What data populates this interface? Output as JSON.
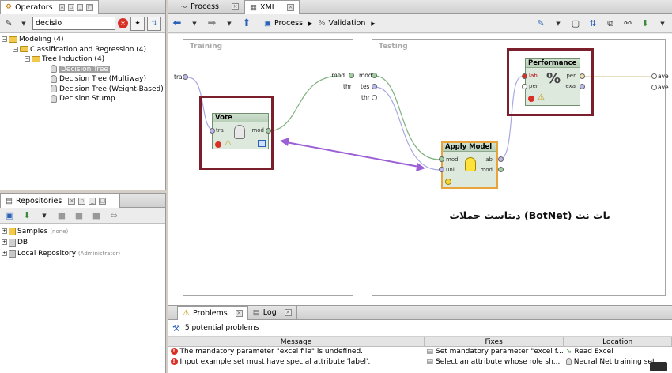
{
  "operators_panel": {
    "tab_label": "Operators",
    "search_value": "decisio",
    "tree": [
      {
        "label": "Modeling (4)",
        "level": 0,
        "kind": "folder"
      },
      {
        "label": "Classification and Regression (4)",
        "level": 1,
        "kind": "folder"
      },
      {
        "label": "Tree Induction (4)",
        "level": 2,
        "kind": "folder"
      },
      {
        "label": "Decision Tree",
        "level": 3,
        "kind": "operator",
        "selected": true
      },
      {
        "label": "Decision Tree (Multiway)",
        "level": 3,
        "kind": "operator"
      },
      {
        "label": "Decision Tree (Weight-Based)",
        "level": 3,
        "kind": "operator"
      },
      {
        "label": "Decision Stump",
        "level": 3,
        "kind": "operator"
      }
    ]
  },
  "repositories_panel": {
    "tab_label": "Repositories",
    "items": [
      {
        "label": "Samples",
        "note": "(none)"
      },
      {
        "label": "DB",
        "note": ""
      },
      {
        "label": "Local Repository",
        "note": "(Administrator)"
      }
    ]
  },
  "process_tabs": {
    "process_label": "Process",
    "xml_label": "XML"
  },
  "process_toolbar": {
    "breadcrumb_process": "Process",
    "breadcrumb_validation": "Validation"
  },
  "canvas": {
    "training_title": "Training",
    "testing_title": "Testing",
    "training_in_port": "tra",
    "training_out_ports": [
      "mod",
      "mod"
    ],
    "testing_in_ports": [
      "tes",
      "thr"
    ],
    "testing_left_ports": [
      "mod",
      "thr"
    ],
    "testing_out_ports": [
      "ave",
      "ave"
    ],
    "vote": {
      "title": "Vote",
      "in_port": "tra",
      "out_port": "mod"
    },
    "apply_model": {
      "title": "Apply Model",
      "in_ports": [
        "mod",
        "unl"
      ],
      "out_ports": [
        "lab",
        "mod"
      ]
    },
    "performance": {
      "title": "Performance",
      "in_ports": [
        "lab",
        "per"
      ],
      "out_ports": [
        "per",
        "exa"
      ],
      "icon_text": "%"
    },
    "annotation": "دیتاست حملات (BotNet) بات نت"
  },
  "problems_panel": {
    "problems_tab": "Problems",
    "log_tab": "Log",
    "summary": "5 potential problems",
    "columns": [
      "Message",
      "Fixes",
      "Location"
    ],
    "rows": [
      {
        "message": "The mandatory parameter \"excel file\" is undefined.",
        "fix": "Set mandatory parameter \"excel f...",
        "location": "Read Excel"
      },
      {
        "message": "Input example set must have special attribute 'label'.",
        "fix": "Select an attribute whose role sh...",
        "location": "Neural Net.training set"
      }
    ]
  },
  "colors": {
    "highlight_box": "#7a1f2b",
    "arrow": "#9b5fd6",
    "operator_fill": "#dde9dd",
    "apply_border": "#e8a33a"
  }
}
